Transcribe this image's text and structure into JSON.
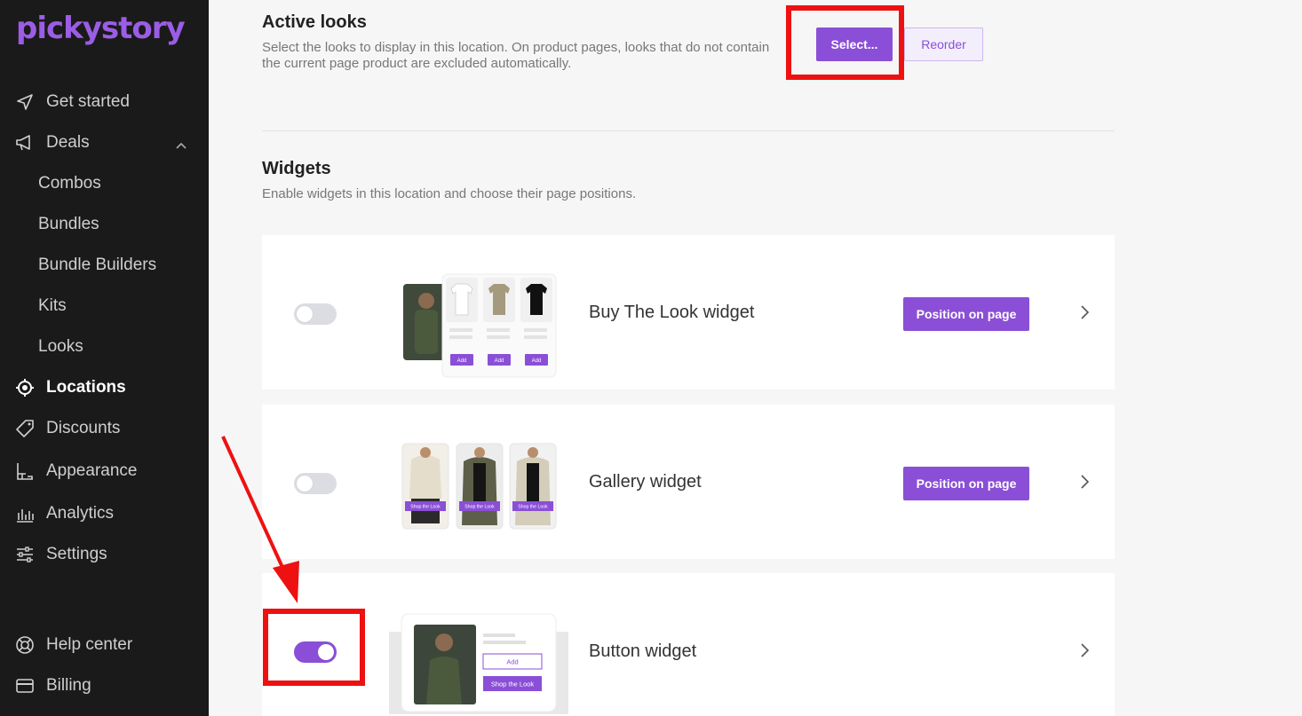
{
  "brand": {
    "name": "pickystory",
    "color": "#9b5de5"
  },
  "sidebar": {
    "items": [
      {
        "label": "Get started",
        "icon": "send-icon"
      },
      {
        "label": "Deals",
        "icon": "megaphone-icon"
      },
      {
        "label": "Combos"
      },
      {
        "label": "Bundles"
      },
      {
        "label": "Bundle Builders"
      },
      {
        "label": "Kits"
      },
      {
        "label": "Looks"
      },
      {
        "label": "Locations",
        "icon": "target-icon"
      },
      {
        "label": "Discounts",
        "icon": "tag-icon"
      },
      {
        "label": "Appearance",
        "icon": "paint-roller-icon"
      },
      {
        "label": "Analytics",
        "icon": "bar-chart-icon"
      },
      {
        "label": "Settings",
        "icon": "sliders-icon"
      },
      {
        "label": "Help center",
        "icon": "lifebuoy-icon"
      },
      {
        "label": "Billing",
        "icon": "credit-card-icon"
      }
    ]
  },
  "active_looks": {
    "title": "Active looks",
    "description_line1": "Select the looks to display in this location. On product pages, looks that do not contain",
    "description_line2": "the current page product are excluded automatically.",
    "select_label": "Select...",
    "reorder_label": "Reorder"
  },
  "widgets": {
    "title": "Widgets",
    "description": "Enable widgets in this location and choose their page positions.",
    "items": [
      {
        "name": "Buy The Look widget",
        "enabled": false,
        "position_label": "Position on page"
      },
      {
        "name": "Gallery widget",
        "enabled": false,
        "position_label": "Position on page"
      },
      {
        "name": "Button widget",
        "enabled": true
      }
    ]
  },
  "previews": {
    "add_label": "Add",
    "shop_the_look_label": "Shop the Look"
  },
  "colors": {
    "accent": "#8a4fd6",
    "highlight": "#ee1111",
    "sidebar_bg": "#1a1a1a"
  }
}
